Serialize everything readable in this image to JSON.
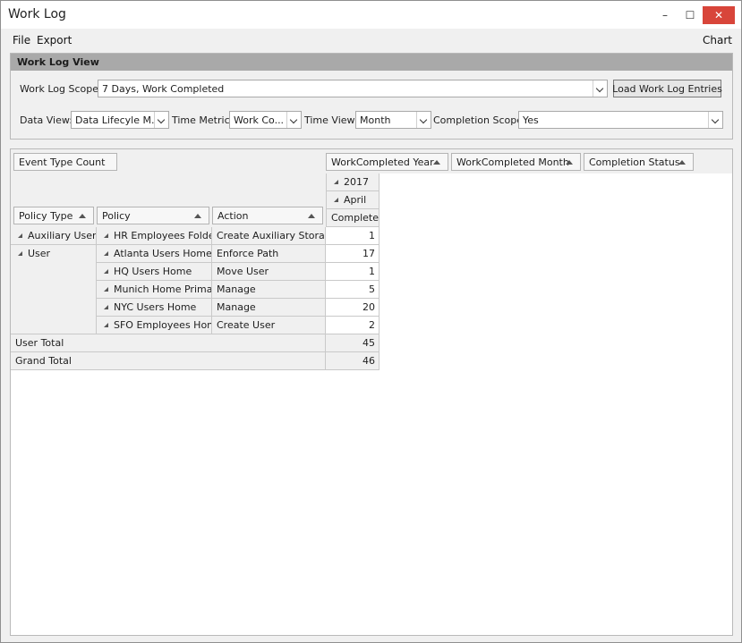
{
  "window": {
    "title": "Work Log",
    "minimize": "–",
    "maximize": "☐",
    "close": "✕"
  },
  "menu": {
    "file": "File",
    "export": "Export",
    "chart": "Chart"
  },
  "panel": {
    "header": "Work Log View",
    "scope_label": "Work Log Scope:",
    "scope_value": "7 Days, Work Completed",
    "load_button": "Load Work Log Entries",
    "data_view_label": "Data View:",
    "data_view_value": "Data Lifecyle M...",
    "time_metric_label": "Time Metric:",
    "time_metric_value": "Work Co...",
    "time_view_label": "Time View:",
    "time_view_value": "Month",
    "completion_scope_label": "Completion Scope:",
    "completion_scope_value": "Yes"
  },
  "pivot": {
    "data_field": "Event Type Count",
    "column_fields": [
      "WorkCompleted Year",
      "WorkCompleted Month",
      "Completion Status"
    ],
    "row_fields": [
      "Policy Type",
      "Policy",
      "Action"
    ],
    "col_headers": {
      "year": "2017",
      "month": "April",
      "status": "Completed"
    },
    "group_aux": "Auxiliary User",
    "group_user": "User",
    "rows": [
      {
        "policy": "HR Employees Folder",
        "action": "Create Auxiliary Storage",
        "value": "1"
      },
      {
        "policy": "Atlanta Users Home",
        "action": "Enforce Path",
        "value": "17"
      },
      {
        "policy": "HQ Users Home",
        "action": "Move User",
        "value": "1"
      },
      {
        "policy": "Munich Home Primary",
        "action": "Manage",
        "value": "5"
      },
      {
        "policy": "NYC Users Home",
        "action": "Manage",
        "value": "20"
      },
      {
        "policy": "SFO Employees Home",
        "action": "Create User",
        "value": "2"
      }
    ],
    "user_total_label": "User Total",
    "user_total_value": "45",
    "grand_total_label": "Grand Total",
    "grand_total_value": "46"
  }
}
